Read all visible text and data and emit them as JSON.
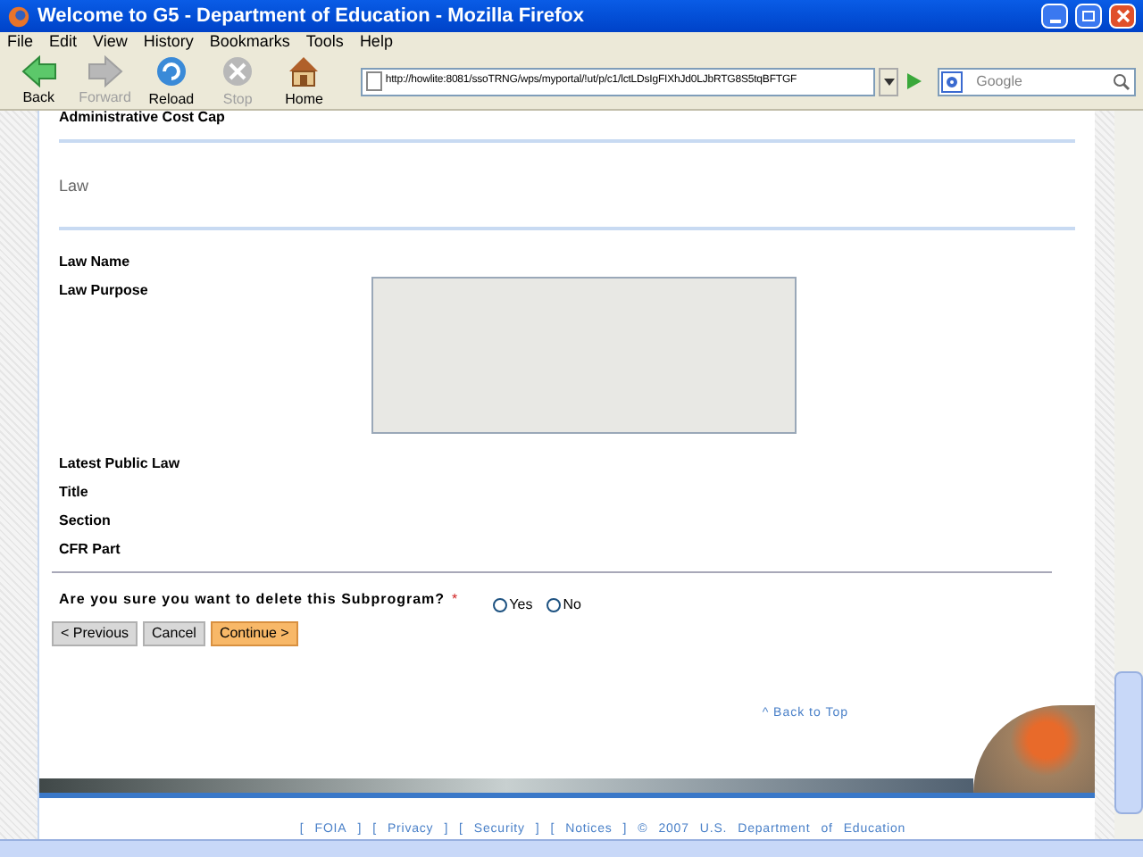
{
  "window": {
    "title": "Welcome to G5 - Department of Education - Mozilla Firefox"
  },
  "menu": [
    "File",
    "Edit",
    "View",
    "History",
    "Bookmarks",
    "Tools",
    "Help"
  ],
  "toolbar": [
    {
      "label": "Back",
      "kind": "back",
      "disabled": false
    },
    {
      "label": "Forward",
      "kind": "forward",
      "disabled": true
    },
    {
      "label": "Reload",
      "kind": "reload",
      "disabled": false
    },
    {
      "label": "Stop",
      "kind": "stop",
      "disabled": true
    },
    {
      "label": "Home",
      "kind": "home",
      "disabled": false
    }
  ],
  "address": {
    "value": "http://howlite:8081/ssoTRNG/wps/myportal/!ut/p/c1/lctLDsIgFIXhJd0LJbRTG8S5tqBFTGF"
  },
  "search": {
    "placeholder": "Google"
  },
  "page": {
    "top_label": "Administrative Cost Cap",
    "section_title": "Law",
    "fields": [
      {
        "label": "Law Name",
        "kind": "text"
      },
      {
        "label": "Law Purpose",
        "kind": "textarea"
      },
      {
        "label": "Latest Public Law",
        "kind": "text"
      },
      {
        "label": "Title",
        "kind": "text"
      },
      {
        "label": "Section",
        "kind": "text"
      },
      {
        "label": "CFR Part",
        "kind": "text"
      }
    ],
    "question": {
      "text": "Are you sure you want to delete this Subprogram?",
      "required_mark": "*",
      "options": [
        {
          "label": "Yes",
          "selected": false
        },
        {
          "label": "No",
          "selected": false
        }
      ]
    },
    "buttons": [
      {
        "label": "< Previous",
        "kind": "plain"
      },
      {
        "label": "Cancel",
        "kind": "plain"
      },
      {
        "label": "Continue >",
        "kind": "primary"
      }
    ],
    "back_to_top": "^ Back to Top",
    "footer": [
      "[",
      "FOIA",
      "]",
      "[",
      "Privacy",
      "]",
      "[",
      "Security",
      "]",
      "[",
      "Notices",
      "]",
      "©",
      "2007",
      "U.S.",
      "Department",
      "of",
      "Education"
    ]
  }
}
